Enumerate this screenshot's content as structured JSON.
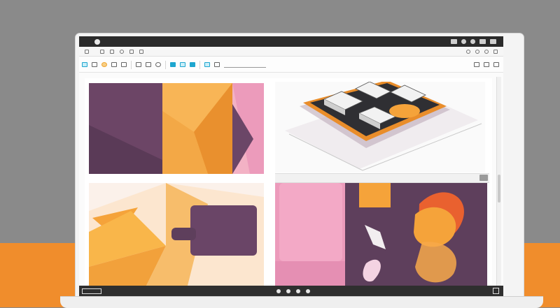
{
  "app": {
    "title": "",
    "colors": {
      "accent": "#1ea6cf",
      "purple": "#5e3f5c",
      "orange": "#f5a33a",
      "pink": "#ec9bbb",
      "desk": "#f08d2c",
      "backdrop": "#8a8a8a"
    }
  },
  "titlebar": {
    "icons": [
      "window-icon",
      "minimize-icon",
      "settings-icon",
      "user-icon",
      "close-icon"
    ]
  },
  "menubar": {
    "items": [
      "",
      "",
      "",
      "",
      "",
      "",
      ""
    ],
    "right_icons": [
      "eye-icon",
      "gear-icon",
      "refresh-icon",
      "share-icon"
    ]
  },
  "toolbar": {
    "tools": [
      "select-tool-icon",
      "crop-tool-icon",
      "lasso-tool-icon",
      "brush-tool-icon",
      "fill-tool-icon",
      "text-tool-icon",
      "shape-tool-icon",
      "layer-tool-icon",
      "move-tool-icon"
    ],
    "dropdown_value": ""
  },
  "panels": [
    {
      "name": "abstract-purple-orange",
      "strip_label": ""
    },
    {
      "name": "isometric-blocks"
    },
    {
      "name": "orange-shapes"
    },
    {
      "name": "pink-purple-abstract"
    }
  ],
  "statusbar": {
    "text": ""
  }
}
